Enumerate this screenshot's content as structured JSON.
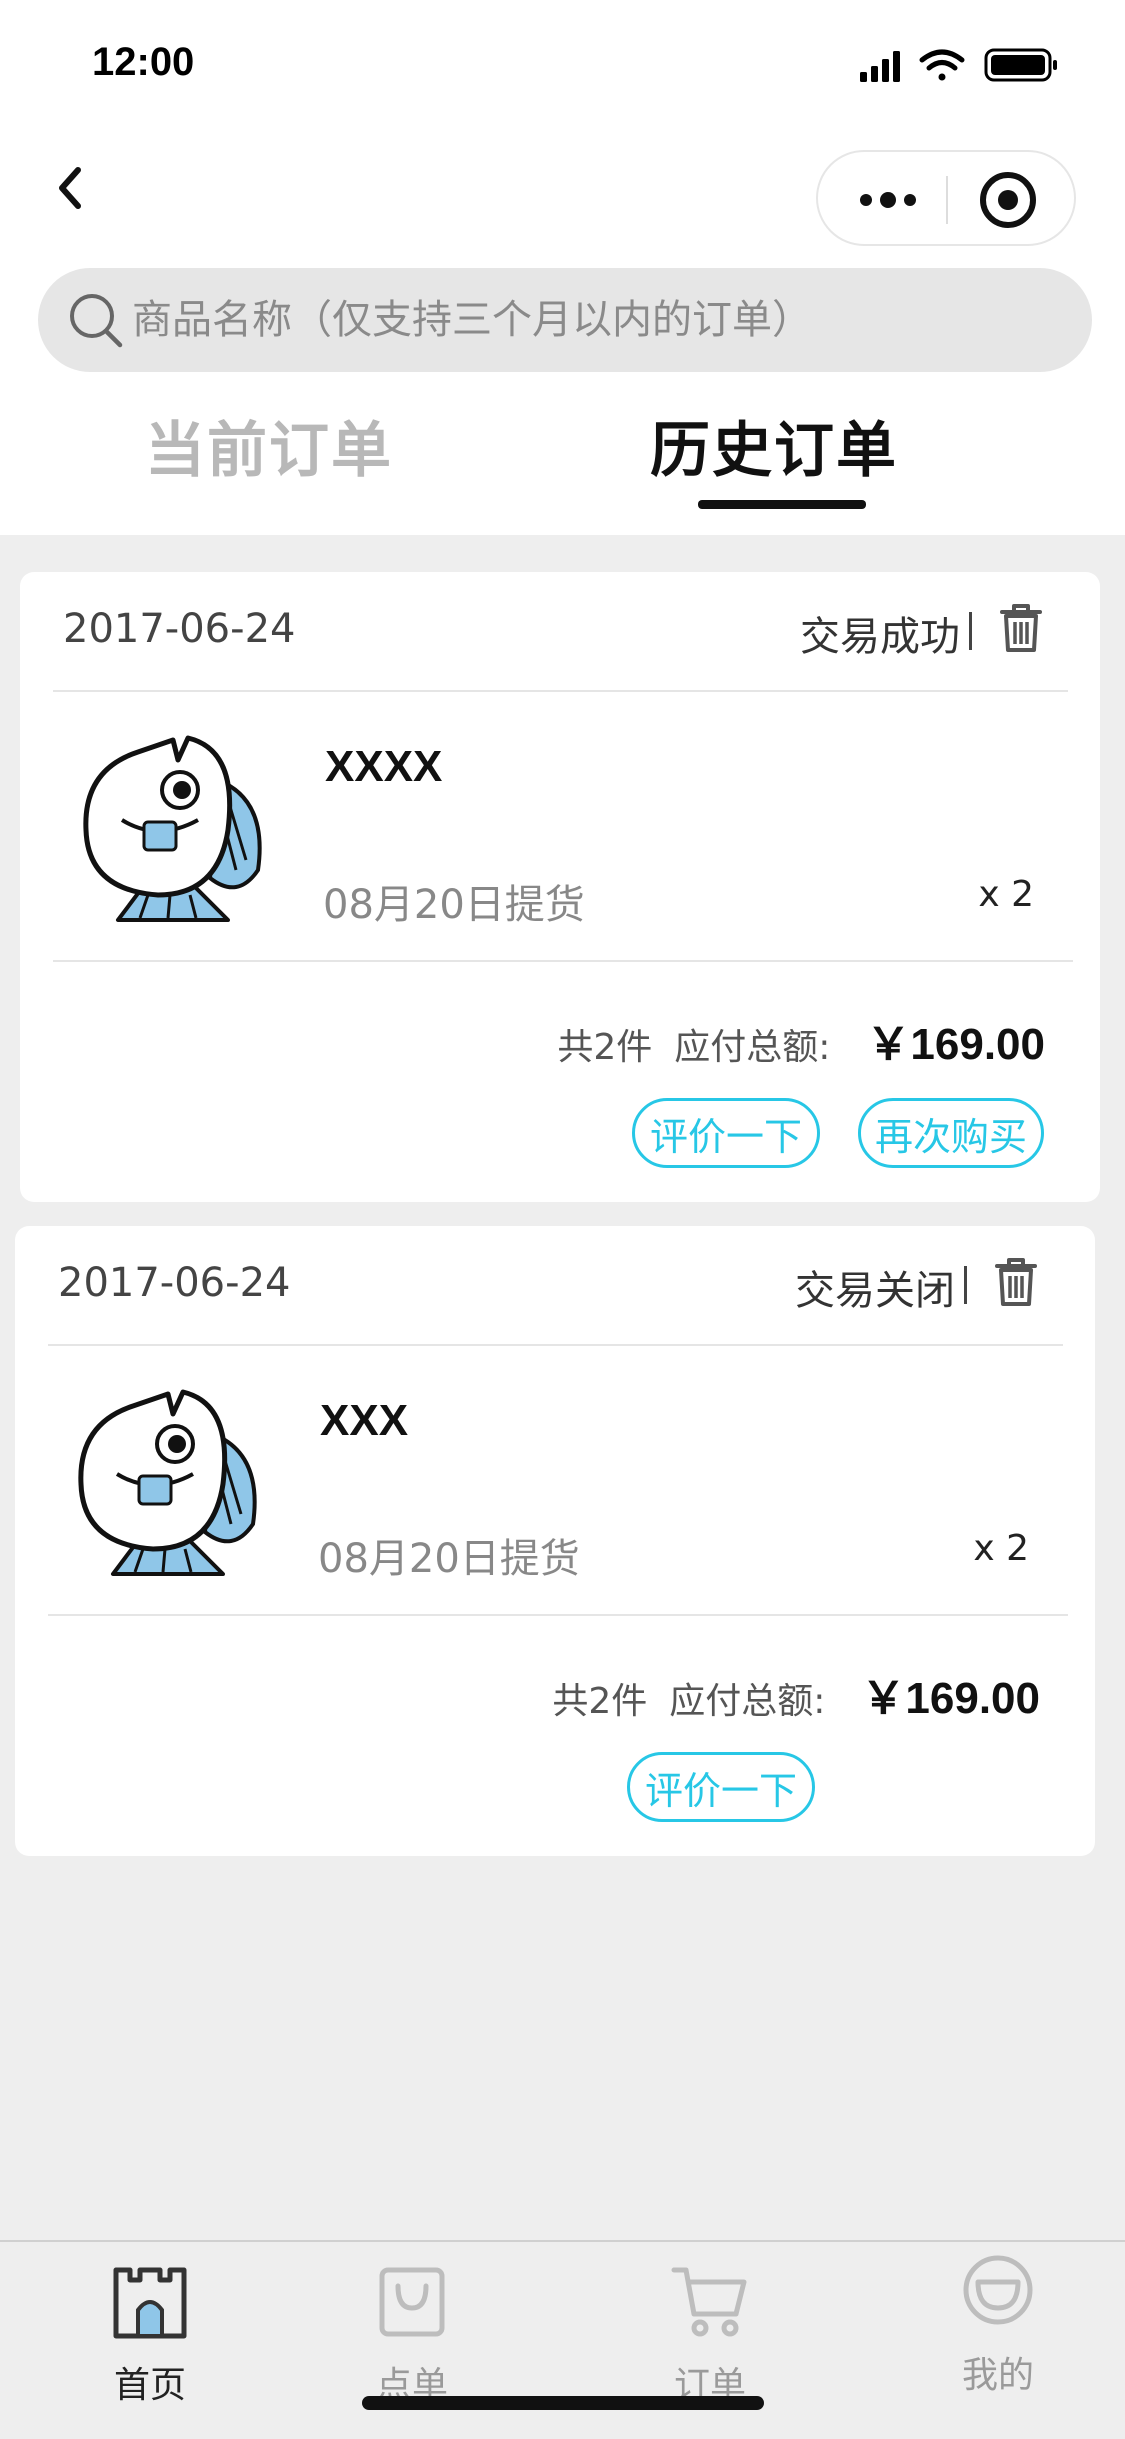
{
  "status_bar": {
    "time": "12:00"
  },
  "search": {
    "placeholder": "商品名称（仅支持三个月以内的订单）"
  },
  "tabs": [
    {
      "label": "当前订单",
      "active": false
    },
    {
      "label": "历史订单",
      "active": true
    }
  ],
  "orders": [
    {
      "date": "2017-06-24",
      "status": "交易成功",
      "product_name": "XXXX",
      "pickup": "08月20日提货",
      "quantity": "x 2",
      "count_text": "共2件",
      "total_label": "应付总额:",
      "total": "￥169.00",
      "actions": [
        "评价一下",
        "再次购买"
      ]
    },
    {
      "date": "2017-06-24",
      "status": "交易关闭",
      "product_name": "XXX",
      "pickup": "08月20日提货",
      "quantity": "x 2",
      "count_text": "共2件",
      "total_label": "应付总额:",
      "total": "￥169.00",
      "actions": [
        "评价一下"
      ]
    }
  ],
  "tabbar": [
    {
      "label": "首页",
      "icon": "castle-icon",
      "active": true
    },
    {
      "label": "点单",
      "icon": "bag-icon",
      "active": false
    },
    {
      "label": "订单",
      "icon": "cart-icon",
      "active": false
    },
    {
      "label": "我的",
      "icon": "face-icon",
      "active": false
    }
  ],
  "colors": {
    "accent": "#27c7e6",
    "active_tab": "#111111",
    "inactive_tab": "#b8b8b8",
    "fish_blue": "#8fc6e8"
  }
}
